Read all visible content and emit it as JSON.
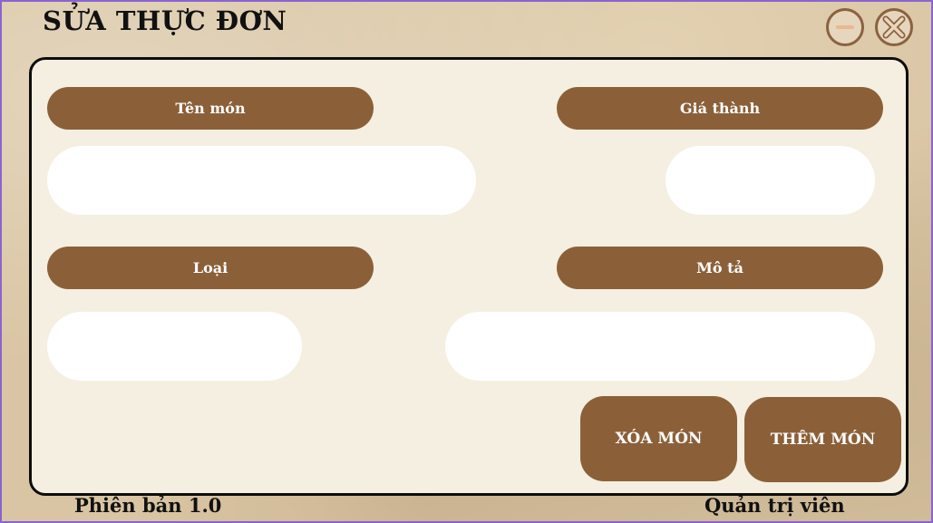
{
  "window": {
    "title": "SỬA THỰC ĐƠN",
    "minimize_icon": "minus-icon",
    "close_icon": "close-icon"
  },
  "form": {
    "name_label": "Tên món",
    "price_label": "Giá thành",
    "type_label": "Loại",
    "description_label": "Mô tả",
    "name_value": "",
    "price_value": "",
    "type_value": "",
    "description_value": ""
  },
  "actions": {
    "delete_label": "XÓA MÓN",
    "add_label": "THÊM MÓN"
  },
  "footer": {
    "version": "Phiên bản 1.0",
    "role": "Quản trị viên"
  },
  "colors": {
    "accent": "#8b6039",
    "panel": "#f4efe1",
    "background": "#d9c5a3"
  }
}
